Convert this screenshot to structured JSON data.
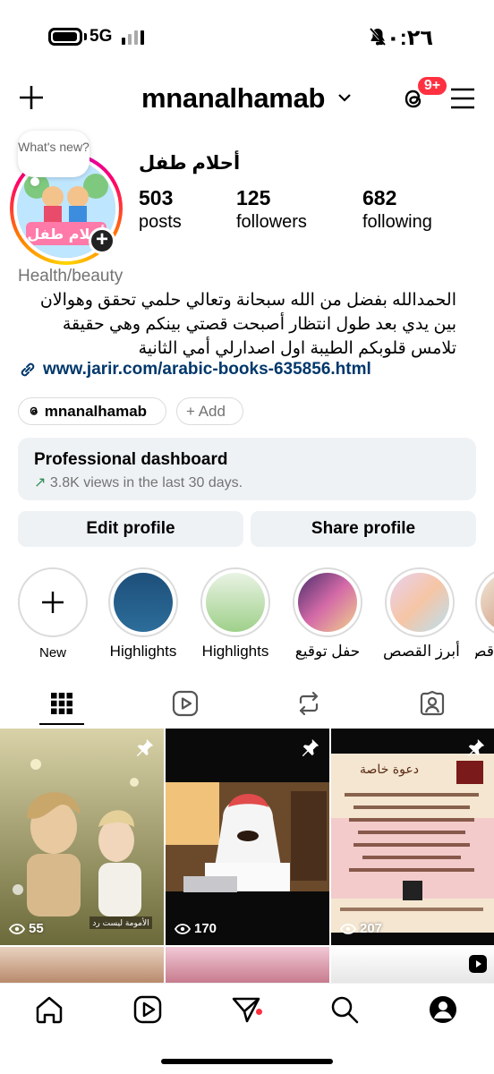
{
  "status_bar": {
    "network": "5G",
    "time": "١٠:٢٦"
  },
  "header": {
    "username": "mnanalhamab",
    "notif_badge": "9+"
  },
  "avatar_bubble": "What's new?",
  "profile": {
    "display_name": "أحلام طفل",
    "stats": [
      {
        "value": "503",
        "label": "posts"
      },
      {
        "value": "125",
        "label": "followers"
      },
      {
        "value": "682",
        "label": "following"
      }
    ],
    "category": "Health/beauty",
    "bio_lines": [
      "الحمدالله بفضل من الله سبحانة وتعالي حلمي تحقق وهوالان",
      "بين يدي بعد طول انتظار أصبحت قصتي بينكم وهي حقيقة",
      "تلامس قلوبكم الطيبة اول اصدارلي أمي الثانية"
    ],
    "link": "www.jarir.com/arabic-books-635856.html",
    "threads_pill": "mnanalhamab",
    "add_pill": "+ Add"
  },
  "dashboard": {
    "title": "Professional dashboard",
    "subtitle": "3.8K views in the last 30 days."
  },
  "buttons": {
    "edit": "Edit profile",
    "share": "Share profile"
  },
  "highlights": [
    {
      "label": "New"
    },
    {
      "label": "Highlights"
    },
    {
      "label": "Highlights"
    },
    {
      "label": "حفل توقيع"
    },
    {
      "label": "أبرز القصص"
    },
    {
      "label": "قص"
    }
  ],
  "grid": [
    {
      "views": "55",
      "caption": "الأمومة ليست رد"
    },
    {
      "views": "170"
    },
    {
      "views": "207",
      "caption": "دعوة خاصة"
    }
  ],
  "colors": {
    "badge": "#ff3040",
    "link": "#00376b",
    "muted": "#737373",
    "panel": "#eff2f5"
  }
}
